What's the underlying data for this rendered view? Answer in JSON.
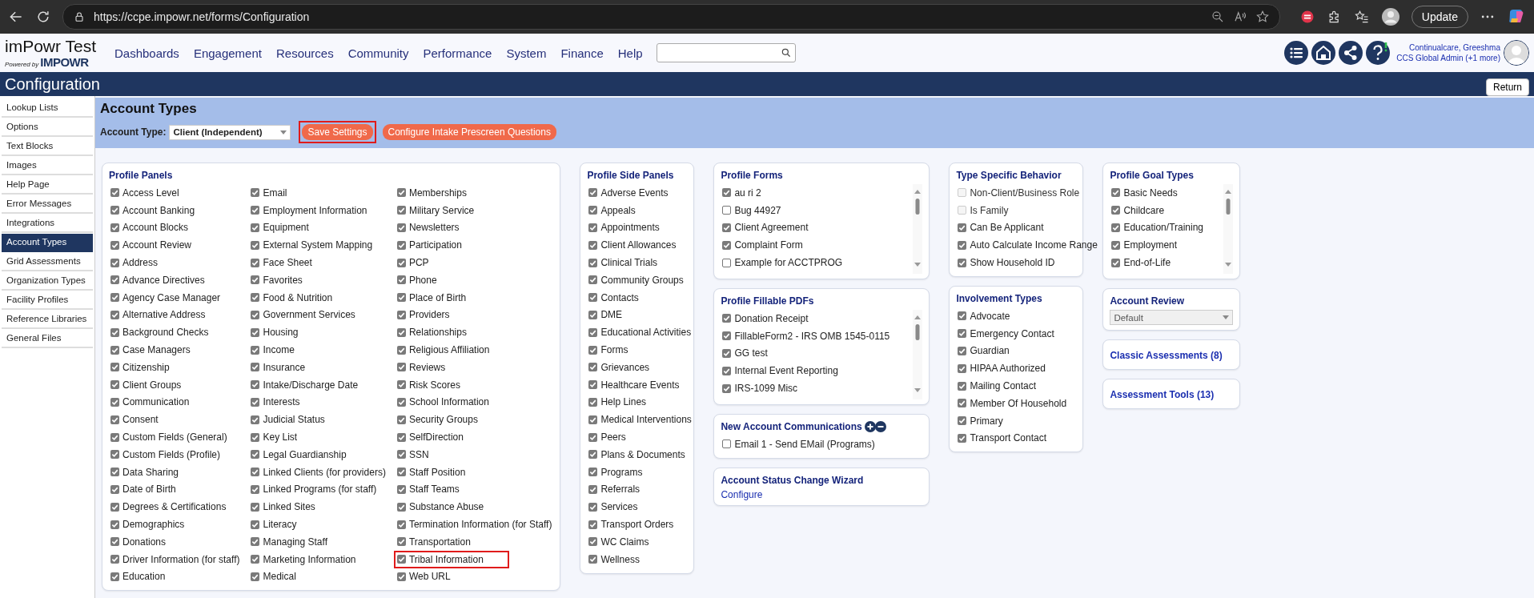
{
  "browser": {
    "url": "https://ccpe.impowr.net/forms/Configuration",
    "update_button": "Update"
  },
  "header": {
    "logo_title": "imPowr Test",
    "powered_by": "Powered by",
    "brand": "IMPOWR",
    "nav": [
      "Dashboards",
      "Engagement",
      "Resources",
      "Community",
      "Performance",
      "System",
      "Finance",
      "Help"
    ],
    "user": {
      "name": "Continualcare, Greeshma",
      "role": "CCS Global Admin (+1 more)"
    }
  },
  "page_title": "Configuration",
  "return_button": "Return",
  "sidebar": {
    "items": [
      {
        "label": "Lookup Lists",
        "selected": false
      },
      {
        "label": "Options",
        "selected": false
      },
      {
        "label": "Text Blocks",
        "selected": false
      },
      {
        "label": "Images",
        "selected": false
      },
      {
        "label": "Help Page",
        "selected": false
      },
      {
        "label": "Error Messages",
        "selected": false
      },
      {
        "label": "Integrations",
        "selected": false
      },
      {
        "label": "Account Types",
        "selected": true
      },
      {
        "label": "Grid Assessments",
        "selected": false
      },
      {
        "label": "Organization Types",
        "selected": false
      },
      {
        "label": "Facility Profiles",
        "selected": false
      },
      {
        "label": "Reference Libraries",
        "selected": false
      },
      {
        "label": "General Files",
        "selected": false
      }
    ]
  },
  "account_types": {
    "title": "Account Types",
    "account_type_label": "Account Type:",
    "account_type_value": "Client (Independent)",
    "buttons": [
      {
        "label": "Save Settings",
        "highlighted": true
      },
      {
        "label": "Configure Intake Prescreen Questions",
        "highlighted": false
      }
    ]
  },
  "profile_panels": {
    "title": "Profile Panels",
    "columns": [
      [
        {
          "label": "Access Level",
          "checked": true,
          "highlighted": false
        },
        {
          "label": "Account Banking",
          "checked": true,
          "highlighted": false
        },
        {
          "label": "Account Blocks",
          "checked": true,
          "highlighted": false
        },
        {
          "label": "Account Review",
          "checked": true,
          "highlighted": false
        },
        {
          "label": "Address",
          "checked": true,
          "highlighted": false
        },
        {
          "label": "Advance Directives",
          "checked": true,
          "highlighted": false
        },
        {
          "label": "Agency Case Manager",
          "checked": true,
          "highlighted": false
        },
        {
          "label": "Alternative Address",
          "checked": true,
          "highlighted": false
        },
        {
          "label": "Background Checks",
          "checked": true,
          "highlighted": false
        },
        {
          "label": "Case Managers",
          "checked": true,
          "highlighted": false
        },
        {
          "label": "Citizenship",
          "checked": true,
          "highlighted": false
        },
        {
          "label": "Client Groups",
          "checked": true,
          "highlighted": false
        },
        {
          "label": "Communication",
          "checked": true,
          "highlighted": false
        },
        {
          "label": "Consent",
          "checked": true,
          "highlighted": false
        },
        {
          "label": "Custom Fields (General)",
          "checked": true,
          "highlighted": false
        },
        {
          "label": "Custom Fields (Profile)",
          "checked": true,
          "highlighted": false
        },
        {
          "label": "Data Sharing",
          "checked": true,
          "highlighted": false
        },
        {
          "label": "Date of Birth",
          "checked": true,
          "highlighted": false
        },
        {
          "label": "Degrees & Certifications",
          "checked": true,
          "highlighted": false
        },
        {
          "label": "Demographics",
          "checked": true,
          "highlighted": false
        },
        {
          "label": "Donations",
          "checked": true,
          "highlighted": false
        },
        {
          "label": "Driver Information (for staff)",
          "checked": true,
          "highlighted": false
        },
        {
          "label": "Education",
          "checked": true,
          "highlighted": false
        }
      ],
      [
        {
          "label": "Email",
          "checked": true,
          "highlighted": false
        },
        {
          "label": "Employment Information",
          "checked": true,
          "highlighted": false
        },
        {
          "label": "Equipment",
          "checked": true,
          "highlighted": false
        },
        {
          "label": "External System Mapping",
          "checked": true,
          "highlighted": false
        },
        {
          "label": "Face Sheet",
          "checked": true,
          "highlighted": false
        },
        {
          "label": "Favorites",
          "checked": true,
          "highlighted": false
        },
        {
          "label": "Food & Nutrition",
          "checked": true,
          "highlighted": false
        },
        {
          "label": "Government Services",
          "checked": true,
          "highlighted": false
        },
        {
          "label": "Housing",
          "checked": true,
          "highlighted": false
        },
        {
          "label": "Income",
          "checked": true,
          "highlighted": false
        },
        {
          "label": "Insurance",
          "checked": true,
          "highlighted": false
        },
        {
          "label": "Intake/Discharge Date",
          "checked": true,
          "highlighted": false
        },
        {
          "label": "Interests",
          "checked": true,
          "highlighted": false
        },
        {
          "label": "Judicial Status",
          "checked": true,
          "highlighted": false
        },
        {
          "label": "Key List",
          "checked": true,
          "highlighted": false
        },
        {
          "label": "Legal Guardianship",
          "checked": true,
          "highlighted": false
        },
        {
          "label": "Linked Clients (for providers)",
          "checked": true,
          "highlighted": false
        },
        {
          "label": "Linked Programs (for staff)",
          "checked": true,
          "highlighted": false
        },
        {
          "label": "Linked Sites",
          "checked": true,
          "highlighted": false
        },
        {
          "label": "Literacy",
          "checked": true,
          "highlighted": false
        },
        {
          "label": "Managing Staff",
          "checked": true,
          "highlighted": false
        },
        {
          "label": "Marketing Information",
          "checked": true,
          "highlighted": false
        },
        {
          "label": "Medical",
          "checked": true,
          "highlighted": false
        }
      ],
      [
        {
          "label": "Memberships",
          "checked": true,
          "highlighted": false
        },
        {
          "label": "Military Service",
          "checked": true,
          "highlighted": false
        },
        {
          "label": "Newsletters",
          "checked": true,
          "highlighted": false
        },
        {
          "label": "Participation",
          "checked": true,
          "highlighted": false
        },
        {
          "label": "PCP",
          "checked": true,
          "highlighted": false
        },
        {
          "label": "Phone",
          "checked": true,
          "highlighted": false
        },
        {
          "label": "Place of Birth",
          "checked": true,
          "highlighted": false
        },
        {
          "label": "Providers",
          "checked": true,
          "highlighted": false
        },
        {
          "label": "Relationships",
          "checked": true,
          "highlighted": false
        },
        {
          "label": "Religious Affiliation",
          "checked": true,
          "highlighted": false
        },
        {
          "label": "Reviews",
          "checked": true,
          "highlighted": false
        },
        {
          "label": "Risk Scores",
          "checked": true,
          "highlighted": false
        },
        {
          "label": "School Information",
          "checked": true,
          "highlighted": false
        },
        {
          "label": "Security Groups",
          "checked": true,
          "highlighted": false
        },
        {
          "label": "SelfDirection",
          "checked": true,
          "highlighted": false
        },
        {
          "label": "SSN",
          "checked": true,
          "highlighted": false
        },
        {
          "label": "Staff Position",
          "checked": true,
          "highlighted": false
        },
        {
          "label": "Staff Teams",
          "checked": true,
          "highlighted": false
        },
        {
          "label": "Substance Abuse",
          "checked": true,
          "highlighted": false
        },
        {
          "label": "Termination Information (for Staff)",
          "checked": true,
          "highlighted": false
        },
        {
          "label": "Transportation",
          "checked": true,
          "highlighted": false
        },
        {
          "label": "Tribal Information",
          "checked": true,
          "highlighted": true
        },
        {
          "label": "Web URL",
          "checked": true,
          "highlighted": false
        }
      ]
    ]
  },
  "side_panels": {
    "title": "Profile Side Panels",
    "items": [
      {
        "label": "Adverse Events",
        "checked": true
      },
      {
        "label": "Appeals",
        "checked": true
      },
      {
        "label": "Appointments",
        "checked": true
      },
      {
        "label": "Client Allowances",
        "checked": true
      },
      {
        "label": "Clinical Trials",
        "checked": true
      },
      {
        "label": "Community Groups",
        "checked": true
      },
      {
        "label": "Contacts",
        "checked": true
      },
      {
        "label": "DME",
        "checked": true
      },
      {
        "label": "Educational Activities",
        "checked": true
      },
      {
        "label": "Forms",
        "checked": true
      },
      {
        "label": "Grievances",
        "checked": true
      },
      {
        "label": "Healthcare Events",
        "checked": true
      },
      {
        "label": "Help Lines",
        "checked": true
      },
      {
        "label": "Medical Interventions",
        "checked": true
      },
      {
        "label": "Peers",
        "checked": true
      },
      {
        "label": "Plans & Documents",
        "checked": true
      },
      {
        "label": "Programs",
        "checked": true
      },
      {
        "label": "Referrals",
        "checked": true
      },
      {
        "label": "Services",
        "checked": true
      },
      {
        "label": "Transport Orders",
        "checked": true
      },
      {
        "label": "WC Claims",
        "checked": true
      },
      {
        "label": "Wellness",
        "checked": true
      }
    ]
  },
  "profile_forms": {
    "title": "Profile Forms",
    "items": [
      {
        "label": "au ri 2",
        "checked": true
      },
      {
        "label": "Bug 44927",
        "checked": false
      },
      {
        "label": "Client Agreement",
        "checked": true
      },
      {
        "label": "Complaint Form",
        "checked": true
      },
      {
        "label": "Example for ACCTPROG",
        "checked": false
      }
    ]
  },
  "fillable_pdfs": {
    "title": "Profile Fillable PDFs",
    "items": [
      {
        "label": "Donation Receipt",
        "checked": true
      },
      {
        "label": "FillableForm2 - IRS OMB 1545-0115",
        "checked": true
      },
      {
        "label": "GG test",
        "checked": true
      },
      {
        "label": "Internal Event Reporting",
        "checked": true
      },
      {
        "label": "IRS-1099 Misc",
        "checked": true
      }
    ]
  },
  "communications": {
    "title": "New Account Communications",
    "items": [
      {
        "label": "Email 1 - Send EMail (Programs)",
        "checked": false
      }
    ]
  },
  "status_wizard": {
    "title": "Account Status Change Wizard",
    "link": "Configure"
  },
  "type_behavior": {
    "title": "Type Specific Behavior",
    "items": [
      {
        "label": "Non-Client/Business Role",
        "checked": false,
        "disabled": true
      },
      {
        "label": "Is Family",
        "checked": false,
        "disabled": true
      },
      {
        "label": "Can Be Applicant",
        "checked": true,
        "disabled": false
      },
      {
        "label": "Auto Calculate Income Range",
        "checked": true,
        "disabled": false
      },
      {
        "label": "Show Household ID",
        "checked": true,
        "disabled": false
      }
    ]
  },
  "involvement_types": {
    "title": "Involvement Types",
    "items": [
      {
        "label": "Advocate",
        "checked": true
      },
      {
        "label": "Emergency Contact",
        "checked": true
      },
      {
        "label": "Guardian",
        "checked": true
      },
      {
        "label": "HIPAA Authorized",
        "checked": true
      },
      {
        "label": "Mailing Contact",
        "checked": true
      },
      {
        "label": "Member Of Household",
        "checked": true
      },
      {
        "label": "Primary",
        "checked": true
      },
      {
        "label": "Transport Contact",
        "checked": true
      }
    ]
  },
  "goal_types": {
    "title": "Profile Goal Types",
    "items": [
      {
        "label": "Basic Needs",
        "checked": true
      },
      {
        "label": "Childcare",
        "checked": true
      },
      {
        "label": "Education/Training",
        "checked": true
      },
      {
        "label": "Employment",
        "checked": true
      },
      {
        "label": "End-of-Life",
        "checked": true
      }
    ]
  },
  "account_review": {
    "title": "Account Review",
    "value": "Default"
  },
  "classic_assessments": {
    "title": "Classic Assessments (8)"
  },
  "assessment_tools": {
    "title": "Assessment Tools (13)"
  }
}
